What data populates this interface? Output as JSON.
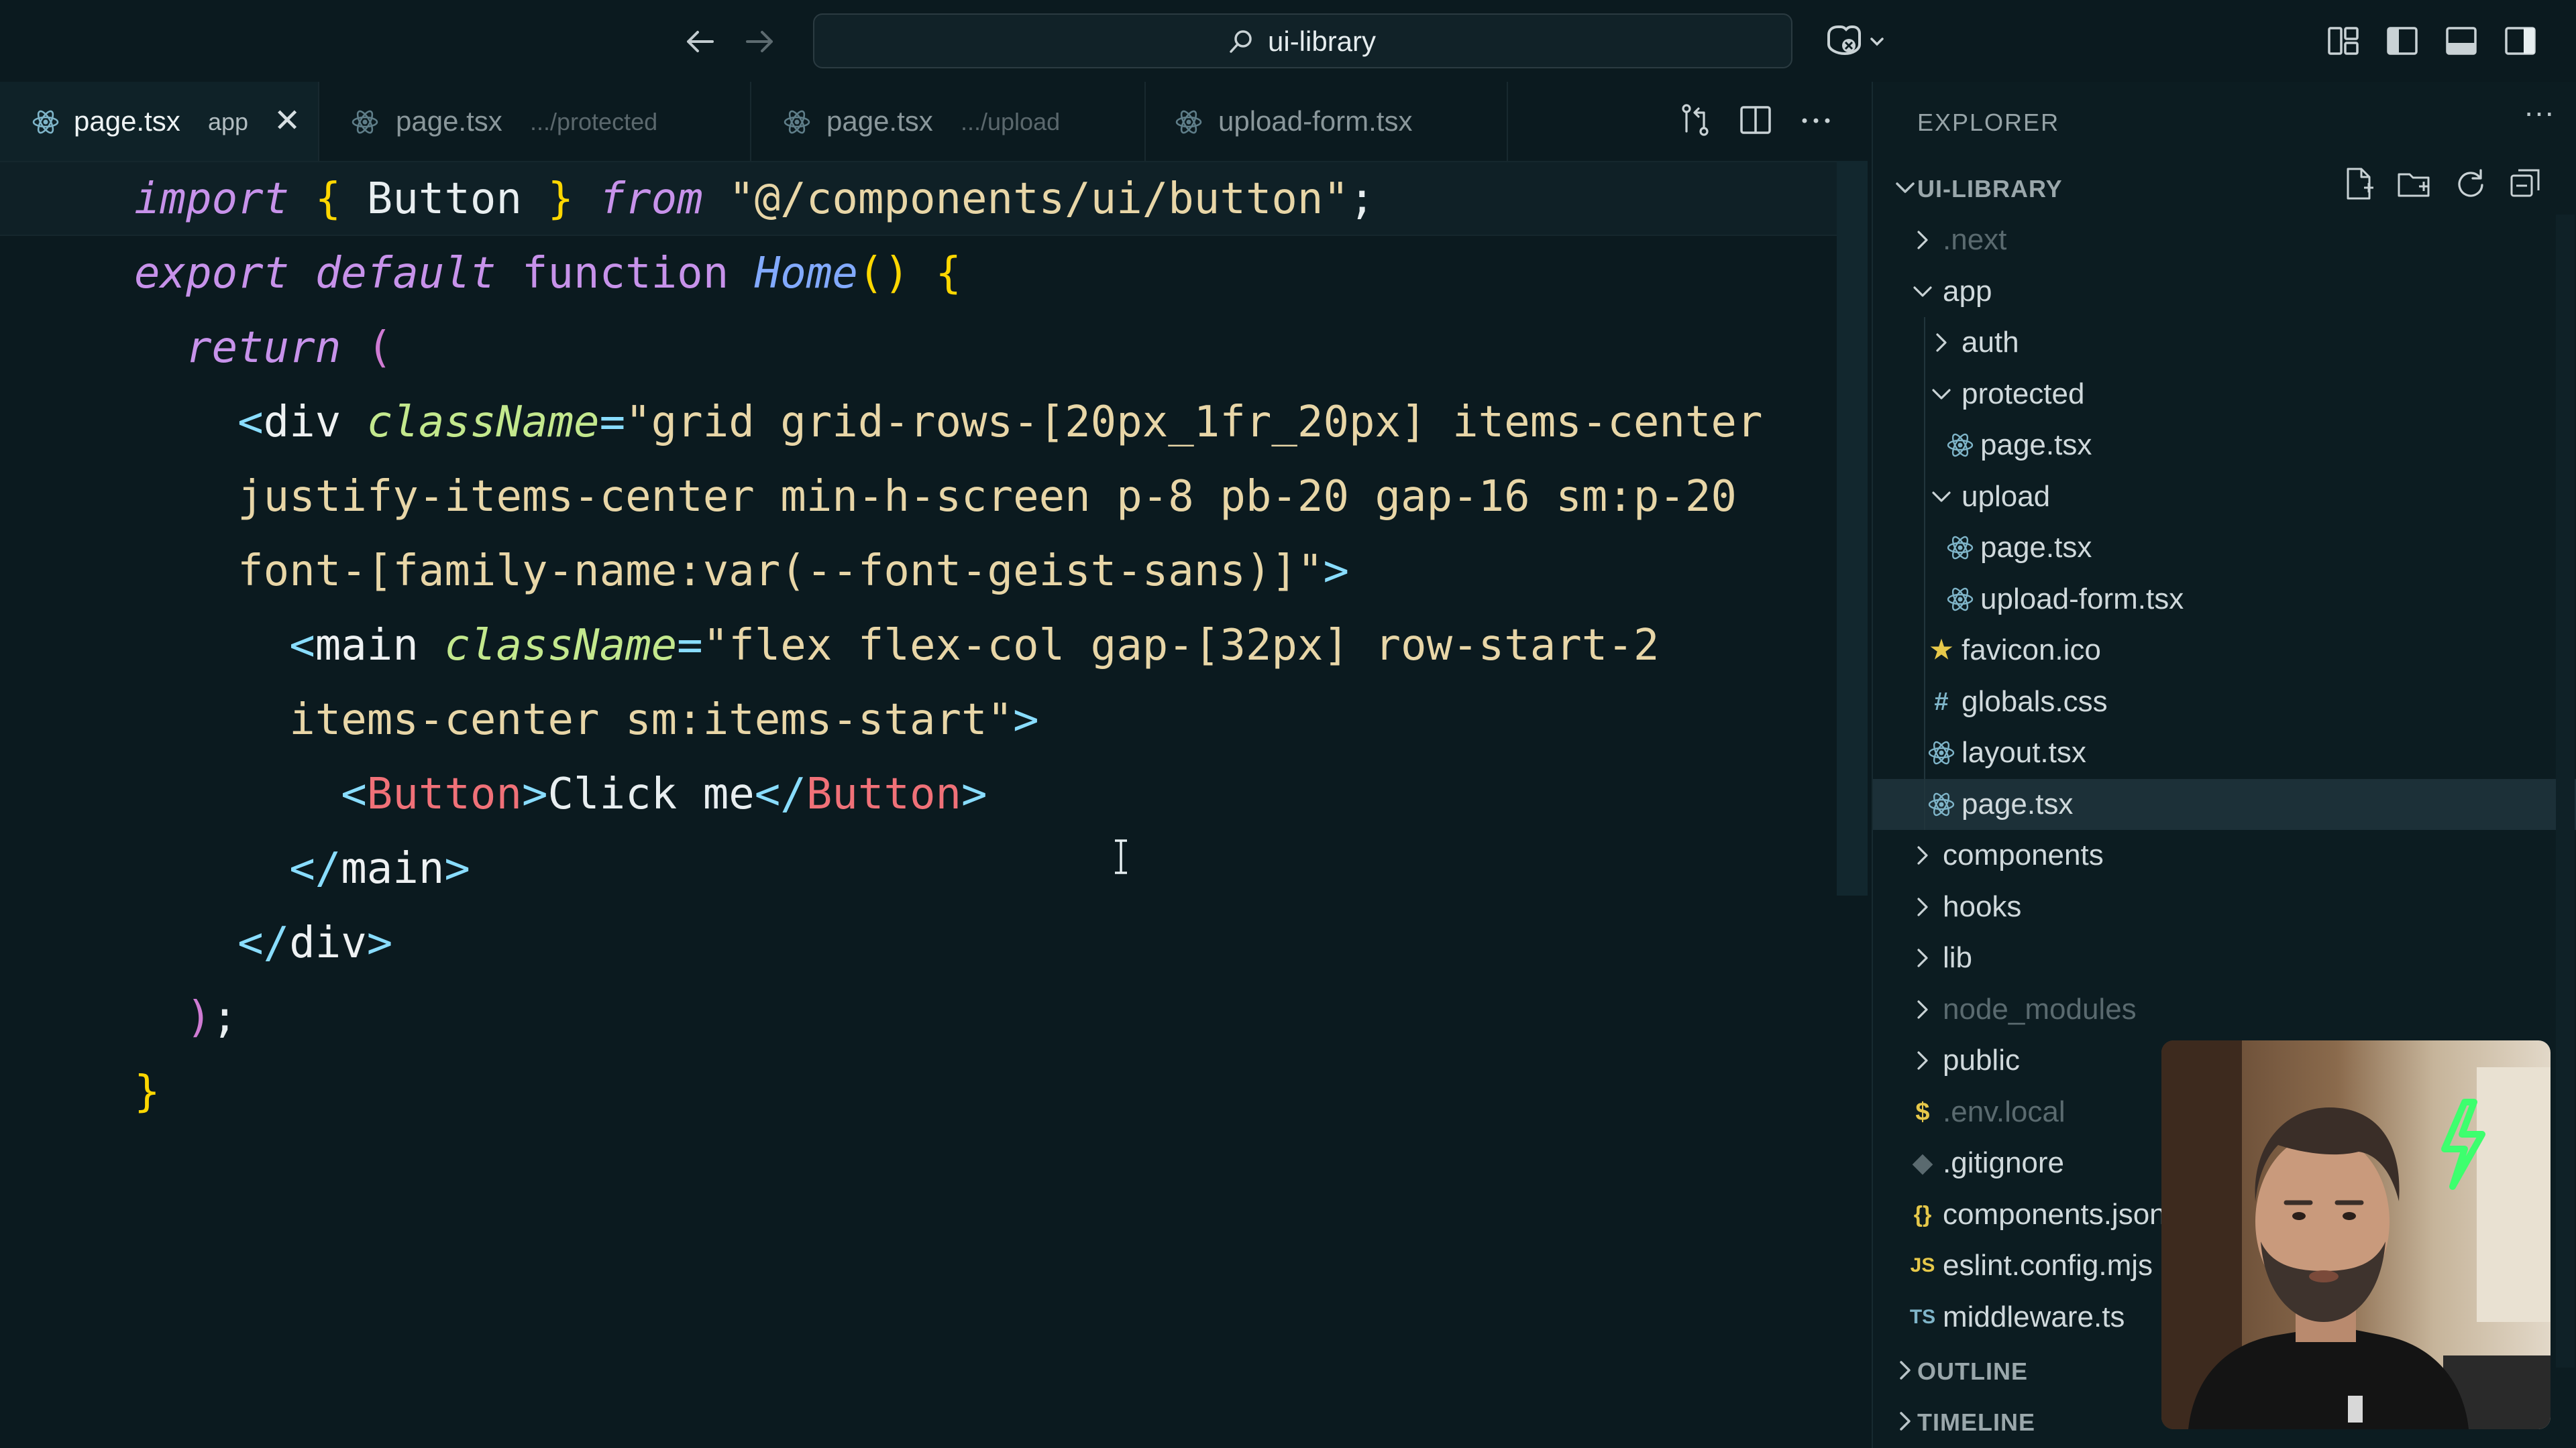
{
  "titlebar": {
    "search_text": "ui-library",
    "icons": [
      "back-arrow-icon",
      "forward-arrow-icon",
      "search-icon",
      "copilot-icon",
      "customize-layout-icon",
      "toggle-primary-sidebar-icon",
      "toggle-panel-icon",
      "toggle-secondary-sidebar-icon"
    ]
  },
  "tabs": [
    {
      "name": "page.tsx",
      "hint": "app",
      "active": true
    },
    {
      "name": "page.tsx",
      "hint": ".../protected",
      "active": false
    },
    {
      "name": "page.tsx",
      "hint": ".../upload",
      "active": false
    },
    {
      "name": "upload-form.tsx",
      "hint": "",
      "active": false
    }
  ],
  "editor": {
    "lines": [
      [
        {
          "c": "k",
          "t": "import"
        },
        {
          "c": "tx",
          "t": " "
        },
        {
          "c": "br",
          "t": "{"
        },
        {
          "c": "tx",
          "t": " Button "
        },
        {
          "c": "br",
          "t": "}"
        },
        {
          "c": "tx",
          "t": " "
        },
        {
          "c": "k",
          "t": "from"
        },
        {
          "c": "tx",
          "t": " "
        },
        {
          "c": "s",
          "t": "\"@/components/ui/button\""
        },
        {
          "c": "tx",
          "t": ";"
        }
      ],
      [
        {
          "c": "k",
          "t": "export"
        },
        {
          "c": "tx",
          "t": " "
        },
        {
          "c": "k",
          "t": "default"
        },
        {
          "c": "tx",
          "t": " "
        },
        {
          "c": "kp",
          "t": "function"
        },
        {
          "c": "tx",
          "t": " "
        },
        {
          "c": "fn",
          "t": "Home"
        },
        {
          "c": "br",
          "t": "()"
        },
        {
          "c": "tx",
          "t": " "
        },
        {
          "c": "br",
          "t": "{"
        }
      ],
      [
        {
          "c": "tx",
          "t": "  "
        },
        {
          "c": "k",
          "t": "return"
        },
        {
          "c": "tx",
          "t": " "
        },
        {
          "c": "ps",
          "t": "("
        }
      ],
      [
        {
          "c": "tx",
          "t": "    "
        },
        {
          "c": "pn",
          "t": "<"
        },
        {
          "c": "tg",
          "t": "div"
        },
        {
          "c": "tx",
          "t": " "
        },
        {
          "c": "at",
          "t": "className"
        },
        {
          "c": "pn",
          "t": "="
        },
        {
          "c": "s",
          "t": "\"grid grid-rows-[20px_1fr_20px] items-center"
        }
      ],
      [
        {
          "c": "tx",
          "t": "    "
        },
        {
          "c": "s",
          "t": "justify-items-center min-h-screen p-8 pb-20 gap-16 sm:p-20"
        }
      ],
      [
        {
          "c": "tx",
          "t": "    "
        },
        {
          "c": "s",
          "t": "font-[family-name:var(--font-geist-sans)]\""
        },
        {
          "c": "pn",
          "t": ">"
        }
      ],
      [
        {
          "c": "tx",
          "t": "      "
        },
        {
          "c": "pn",
          "t": "<"
        },
        {
          "c": "tg",
          "t": "main"
        },
        {
          "c": "tx",
          "t": " "
        },
        {
          "c": "at",
          "t": "className"
        },
        {
          "c": "pn",
          "t": "="
        },
        {
          "c": "s",
          "t": "\"flex flex-col gap-[32px] row-start-2"
        }
      ],
      [
        {
          "c": "tx",
          "t": "      "
        },
        {
          "c": "s",
          "t": "items-center sm:items-start\""
        },
        {
          "c": "pn",
          "t": ">"
        }
      ],
      [
        {
          "c": "tx",
          "t": "        "
        },
        {
          "c": "pn",
          "t": "<"
        },
        {
          "c": "cp",
          "t": "Button"
        },
        {
          "c": "pn",
          "t": ">"
        },
        {
          "c": "tx",
          "t": "Click me"
        },
        {
          "c": "pn",
          "t": "</"
        },
        {
          "c": "cp",
          "t": "Button"
        },
        {
          "c": "pn",
          "t": ">"
        }
      ],
      [
        {
          "c": "tx",
          "t": "      "
        },
        {
          "c": "pn",
          "t": "</"
        },
        {
          "c": "tg",
          "t": "main"
        },
        {
          "c": "pn",
          "t": ">"
        }
      ],
      [
        {
          "c": "tx",
          "t": "    "
        },
        {
          "c": "pn",
          "t": "</"
        },
        {
          "c": "tg",
          "t": "div"
        },
        {
          "c": "pn",
          "t": ">"
        }
      ],
      [
        {
          "c": "tx",
          "t": "  "
        },
        {
          "c": "ps",
          "t": ")"
        },
        {
          "c": "tx",
          "t": ";"
        }
      ],
      [
        {
          "c": "br",
          "t": "}"
        }
      ]
    ]
  },
  "sidebar": {
    "title": "EXPLORER",
    "more": "···",
    "root_label": "UI-LIBRARY",
    "tree": [
      {
        "name": ".next",
        "kind": "folder",
        "open": false,
        "depth": 0,
        "dim": true
      },
      {
        "name": "app",
        "kind": "folder",
        "open": true,
        "depth": 0
      },
      {
        "name": "auth",
        "kind": "folder",
        "open": false,
        "depth": 1
      },
      {
        "name": "protected",
        "kind": "folder",
        "open": true,
        "depth": 1
      },
      {
        "name": "page.tsx",
        "kind": "react",
        "depth": 2
      },
      {
        "name": "upload",
        "kind": "folder",
        "open": true,
        "depth": 1
      },
      {
        "name": "page.tsx",
        "kind": "react",
        "depth": 2
      },
      {
        "name": "upload-form.tsx",
        "kind": "react",
        "depth": 2
      },
      {
        "name": "favicon.ico",
        "kind": "star",
        "depth": 1
      },
      {
        "name": "globals.css",
        "kind": "hash",
        "depth": 1
      },
      {
        "name": "layout.tsx",
        "kind": "react",
        "depth": 1
      },
      {
        "name": "page.tsx",
        "kind": "react",
        "depth": 1,
        "selected": true
      },
      {
        "name": "components",
        "kind": "folder",
        "open": false,
        "depth": 0
      },
      {
        "name": "hooks",
        "kind": "folder",
        "open": false,
        "depth": 0
      },
      {
        "name": "lib",
        "kind": "folder",
        "open": false,
        "depth": 0
      },
      {
        "name": "node_modules",
        "kind": "folder",
        "open": false,
        "depth": 0,
        "dim": true
      },
      {
        "name": "public",
        "kind": "folder",
        "open": false,
        "depth": 0
      },
      {
        "name": ".env.local",
        "kind": "dollar",
        "depth": 0,
        "dim": true
      },
      {
        "name": ".gitignore",
        "kind": "git",
        "depth": 0
      },
      {
        "name": "components.json",
        "kind": "json",
        "depth": 0
      },
      {
        "name": "eslint.config.mjs",
        "kind": "js",
        "depth": 0
      },
      {
        "name": "middleware.ts",
        "kind": "ts",
        "depth": 0
      }
    ],
    "outline_label": "OUTLINE",
    "timeline_label": "TIMELINE"
  },
  "file_icon_glyphs": {
    "star": "★",
    "hash": "#",
    "dollar": "$",
    "git": "◆",
    "json": "{}",
    "js": "JS",
    "ts": "TS"
  },
  "colors": {
    "background": "#0b1a1f",
    "sidebar": "#0c1c21",
    "selection": "#1c3038",
    "keyword": "#c792ea",
    "string": "#e8d6a7",
    "attribute": "#c3e88d",
    "function": "#82aaff",
    "bracket": "#ffd700",
    "component": "#f07178",
    "react_icon": "#7fb5c9"
  }
}
